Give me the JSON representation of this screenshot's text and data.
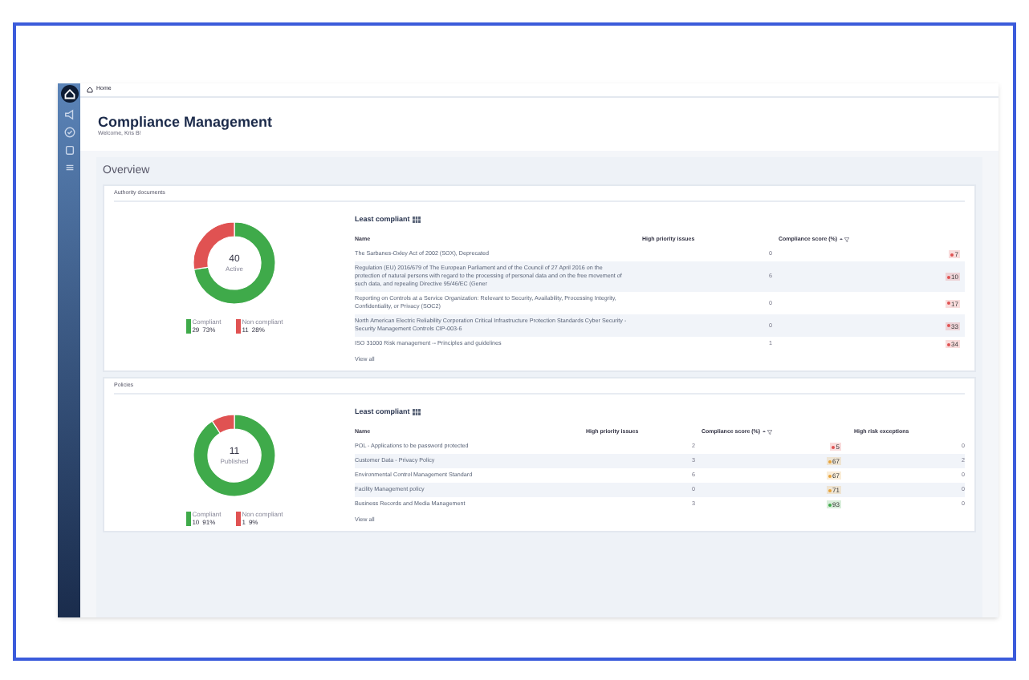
{
  "breadcrumb": "Home",
  "title": "Compliance Management",
  "welcome": "Welcome, Kris B!",
  "overview": "Overview",
  "sections": [
    {
      "title": "Authority documents",
      "total": "40",
      "total_label": "Active",
      "chart_data": {
        "type": "donut",
        "categories": [
          "Compliant",
          "Non compliant"
        ],
        "values": [
          72.5,
          27.5
        ]
      },
      "legend": [
        {
          "count": "29",
          "percent": "73%",
          "color": "#3faa4a"
        },
        {
          "count": "11",
          "percent": "28%",
          "color": "#e05252"
        }
      ],
      "list_title": "Least compliant",
      "columns": [
        "Name",
        "High priority issues",
        "Compliance score (%)"
      ],
      "rows": [
        {
          "name": "The Sarbanes-Oxley Act of 2002 (SOX), Deprecated",
          "issues": "0",
          "score": "7",
          "color": "#e05252"
        },
        {
          "name": "Regulation (EU) 2016/679 of The European Parliament and of the Council of 27 April 2016 on the protection of natural persons with regard to the processing of personal data and on the free movement of such data, and repealing Directive 95/46/EC (Gener",
          "issues": "6",
          "score": "10",
          "color": "#e05252"
        },
        {
          "name": "Reporting on Controls at a Service Organization: Relevant to Security, Availability, Processing Integrity, Confidentiality, or Privacy (SOC2)",
          "issues": "0",
          "score": "17",
          "color": "#e05252"
        },
        {
          "name": "North American Electric Reliability Corporation Critical Infrastructure Protection Standards Cyber Security - Security Management Controls CIP-003-6",
          "issues": "0",
          "score": "33",
          "color": "#e05252"
        },
        {
          "name": "ISO 31000 Risk management -- Principles and guidelines",
          "issues": "1",
          "score": "34",
          "color": "#e05252"
        }
      ],
      "view_all": "View all"
    },
    {
      "title": "Policies",
      "total": "11",
      "total_label": "Published",
      "chart_data": {
        "type": "donut",
        "categories": [
          "Compliant",
          "Non compliant"
        ],
        "values": [
          90.9,
          9.1
        ]
      },
      "legend": [
        {
          "count": "10",
          "percent": "91%",
          "color": "#3faa4a"
        },
        {
          "count": "1",
          "percent": "9%",
          "color": "#e05252"
        }
      ],
      "list_title": "Least compliant",
      "columns": [
        "Name",
        "High priority issues",
        "Compliance score (%)",
        "High risk exceptions"
      ],
      "rows": [
        {
          "name": "POL - Applications to be password protected",
          "issues": "2",
          "score": "5",
          "color": "#e05252",
          "exceptions": "0"
        },
        {
          "name": "Customer Data -  Privacy Policy",
          "issues": "3",
          "score": "67",
          "color": "#e8a33a",
          "exceptions": "2"
        },
        {
          "name": "Environmental Control Management Standard",
          "issues": "6",
          "score": "67",
          "color": "#e8a33a",
          "exceptions": "0"
        },
        {
          "name": "Facility Management policy",
          "issues": "0",
          "score": "71",
          "color": "#e8a33a",
          "exceptions": "0"
        },
        {
          "name": "Business Records and Media Management",
          "issues": "3",
          "score": "93",
          "color": "#3faa4a",
          "exceptions": "0"
        }
      ],
      "view_all": "View all"
    }
  ]
}
